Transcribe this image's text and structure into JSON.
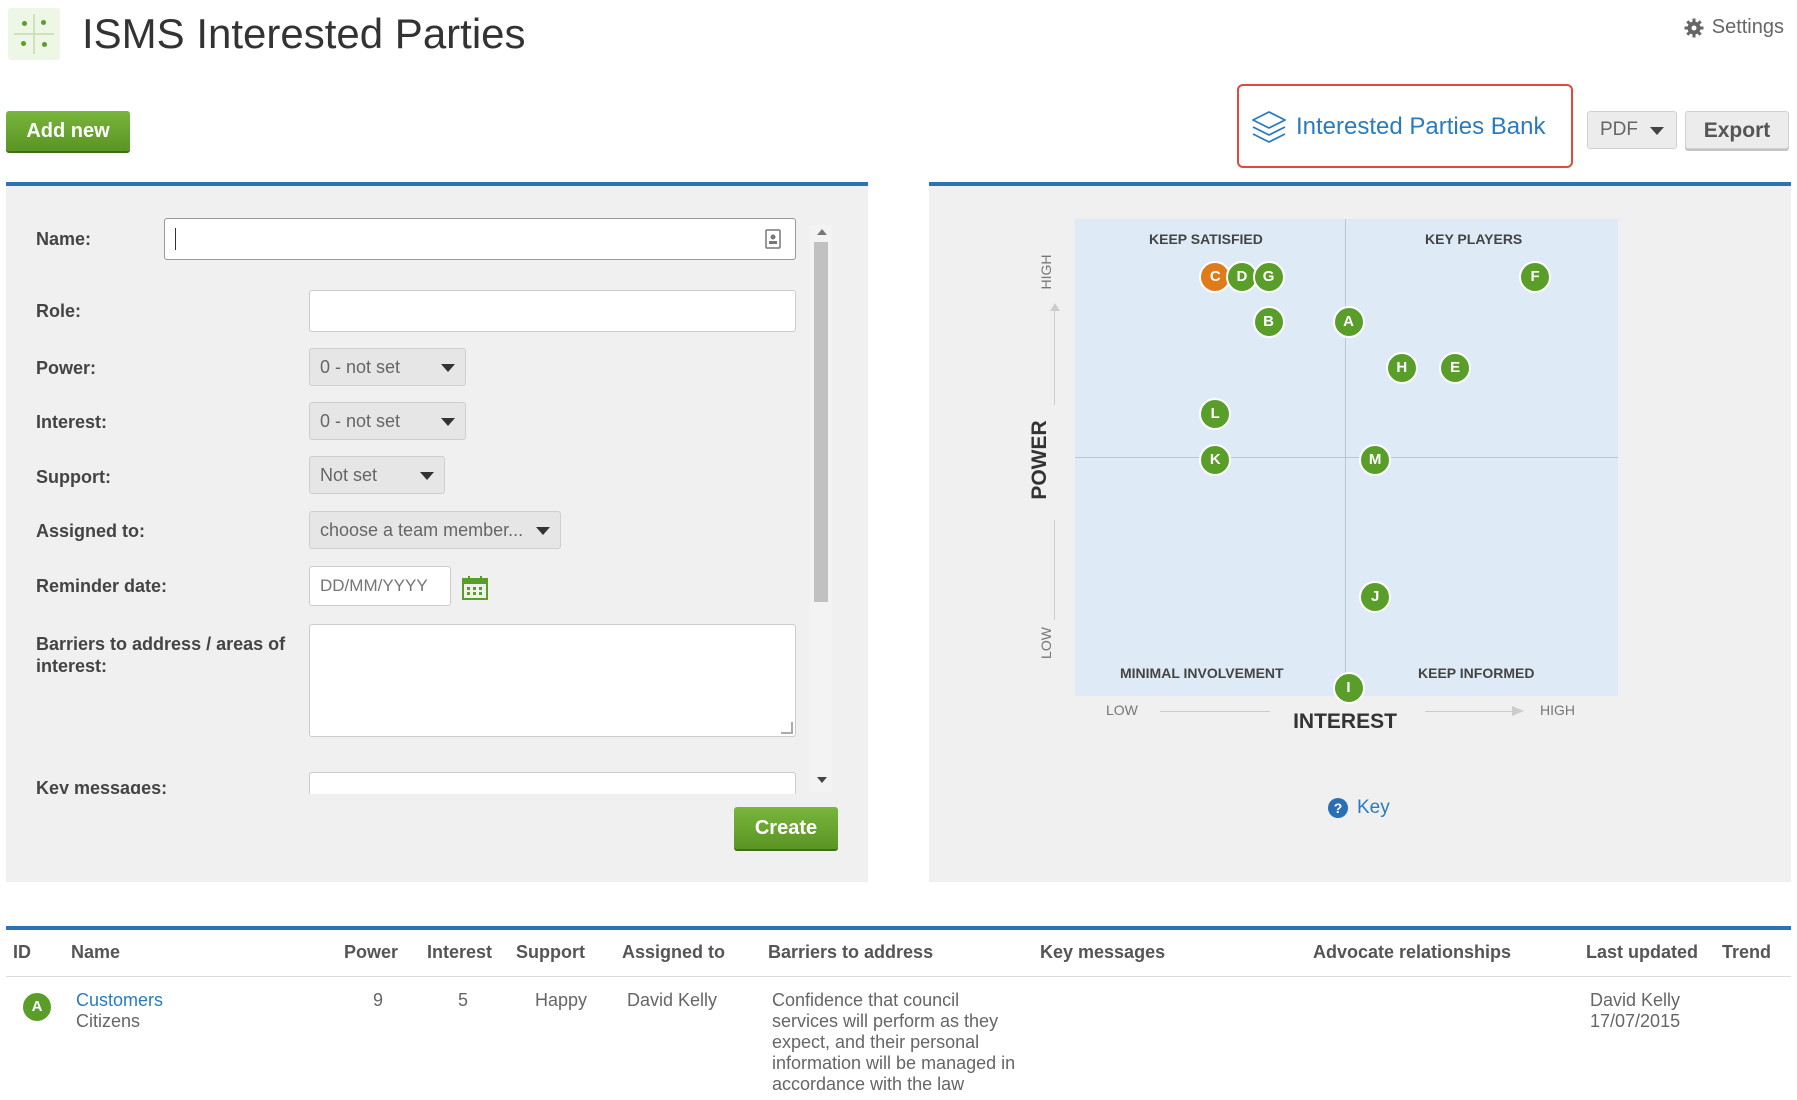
{
  "header": {
    "title": "ISMS Interested Parties",
    "settings_label": "Settings"
  },
  "toolbar": {
    "add_new_label": "Add new",
    "bank_label": "Interested Parties Bank",
    "pdf_label": "PDF",
    "export_label": "Export"
  },
  "form": {
    "name_label": "Name:",
    "role_label": "Role:",
    "power_label": "Power:",
    "power_value": "0 - not set",
    "interest_label": "Interest:",
    "interest_value": "0 - not set",
    "support_label": "Support:",
    "support_value": "Not set",
    "assigned_label": "Assigned to:",
    "assigned_value": "choose a team member...",
    "reminder_label": "Reminder date:",
    "reminder_placeholder": "DD/MM/YYYY",
    "barriers_label": "Barriers to address / areas of interest:",
    "key_messages_label": "Key messages:",
    "create_label": "Create"
  },
  "matrix": {
    "quadrants": {
      "top_left": "KEEP SATISFIED",
      "top_right": "KEY PLAYERS",
      "bottom_left": "MINIMAL INVOLVEMENT",
      "bottom_right": "KEEP INFORMED"
    },
    "y_axis": {
      "title": "POWER",
      "high": "HIGH",
      "low": "LOW"
    },
    "x_axis": {
      "title": "INTEREST",
      "low": "LOW",
      "high": "HIGH"
    },
    "key_label": "Key",
    "points": [
      {
        "id": "C",
        "interest": 2.5,
        "power": 9,
        "color": "#e07b1a"
      },
      {
        "id": "D",
        "interest": 3,
        "power": 9,
        "color": "#5a9e2a"
      },
      {
        "id": "G",
        "interest": 3.5,
        "power": 9,
        "color": "#5a9e2a"
      },
      {
        "id": "F",
        "interest": 8.5,
        "power": 9,
        "color": "#5a9e2a"
      },
      {
        "id": "B",
        "interest": 3.5,
        "power": 8,
        "color": "#5a9e2a"
      },
      {
        "id": "A",
        "interest": 5,
        "power": 8,
        "color": "#5a9e2a"
      },
      {
        "id": "H",
        "interest": 6,
        "power": 7,
        "color": "#5a9e2a"
      },
      {
        "id": "E",
        "interest": 7,
        "power": 7,
        "color": "#5a9e2a"
      },
      {
        "id": "L",
        "interest": 2.5,
        "power": 6,
        "color": "#5a9e2a"
      },
      {
        "id": "K",
        "interest": 2.5,
        "power": 5,
        "color": "#5a9e2a"
      },
      {
        "id": "M",
        "interest": 5.5,
        "power": 5,
        "color": "#5a9e2a"
      },
      {
        "id": "J",
        "interest": 5.5,
        "power": 2,
        "color": "#5a9e2a"
      },
      {
        "id": "I",
        "interest": 5,
        "power": 0,
        "color": "#5a9e2a"
      }
    ]
  },
  "table": {
    "headers": {
      "id": "ID",
      "name": "Name",
      "power": "Power",
      "interest": "Interest",
      "support": "Support",
      "assigned": "Assigned to",
      "barriers": "Barriers to address",
      "key_messages": "Key messages",
      "advocate": "Advocate relationships",
      "last_updated": "Last updated",
      "trend": "Trend"
    },
    "rows": [
      {
        "id": "A",
        "name": "Customers",
        "role": "Citizens",
        "power": "9",
        "interest": "5",
        "support": "Happy",
        "assigned": "David Kelly",
        "barriers": [
          "Confidence that council",
          "services will perform as they",
          "expect, and their personal",
          "information will be managed in",
          "accordance with the law"
        ],
        "updated_by": "David Kelly",
        "updated_date": "17/07/2015"
      }
    ]
  },
  "colors": {
    "accent_blue": "#2b73b3",
    "green": "#5a9e2a",
    "orange": "#e07b1a",
    "highlight_red": "#e04a3a"
  }
}
